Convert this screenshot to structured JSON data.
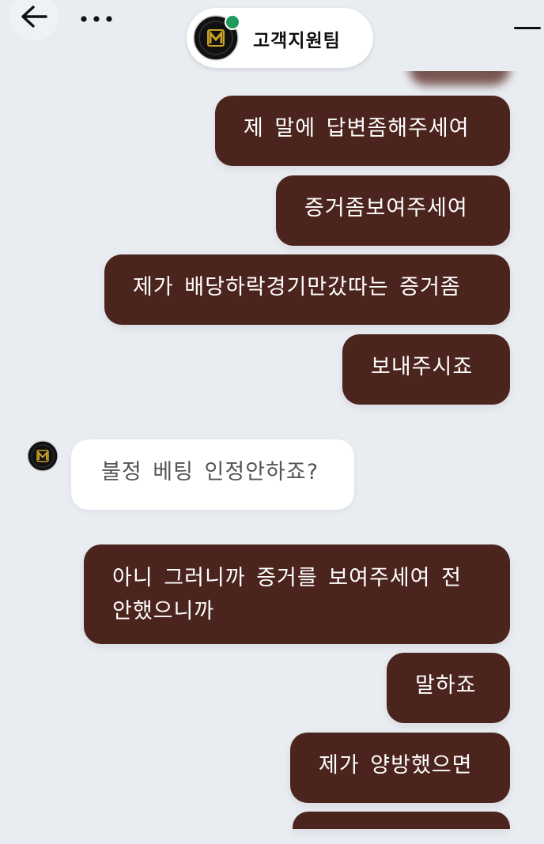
{
  "header": {
    "title": "고객지원팀",
    "avatar_logo_letter": "m",
    "status": "online"
  },
  "icons": {
    "back": "arrow-left-icon",
    "more": "ellipsis-icon",
    "minimize": "minimize-icon"
  },
  "colors": {
    "background": "#e9edf2",
    "outgoing_bubble": "#4c241e",
    "incoming_bubble": "#ffffff",
    "online": "#1e9b5a",
    "logo_gold": "#c9a227"
  },
  "messages": [
    {
      "sender": "user",
      "text": "제 말에 답변좀해주세여"
    },
    {
      "sender": "user",
      "text": "증거좀보여주세여"
    },
    {
      "sender": "user",
      "text": "제가 배당하락경기만갔따는 증거좀"
    },
    {
      "sender": "user",
      "text": "보내주시죠"
    },
    {
      "sender": "agent",
      "text": "불정 베팅 인정안하죠?"
    },
    {
      "sender": "user",
      "text": "아니 그러니까 증거를 보여주세여 전",
      "text_line2": "안했으니까"
    },
    {
      "sender": "user",
      "text": "말하죠"
    },
    {
      "sender": "user",
      "text": "제가 양방했으면"
    }
  ]
}
